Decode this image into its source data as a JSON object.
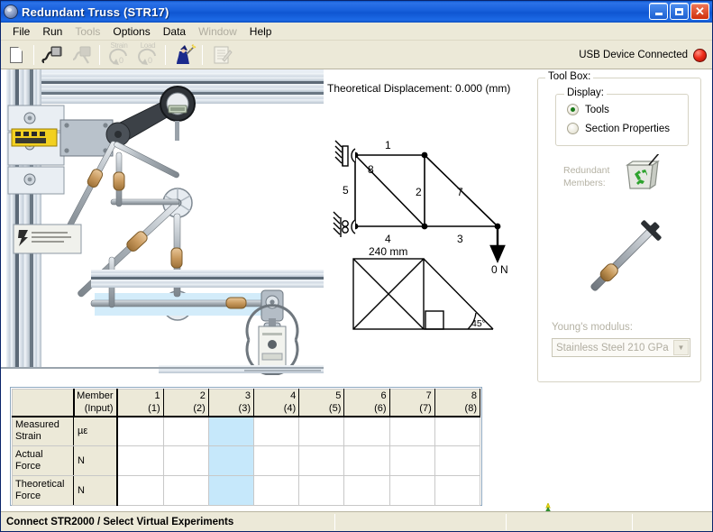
{
  "window": {
    "title": "Redundant Truss (STR17)",
    "icon": "app-globe-icon",
    "minimize": "–",
    "maximize": "❐",
    "close": "✕"
  },
  "menu": [
    {
      "label": "File",
      "enabled": true
    },
    {
      "label": "Run",
      "enabled": true
    },
    {
      "label": "Tools",
      "enabled": false
    },
    {
      "label": "Options",
      "enabled": true
    },
    {
      "label": "Data",
      "enabled": true
    },
    {
      "label": "Window",
      "enabled": false
    },
    {
      "label": "Help",
      "enabled": true
    }
  ],
  "toolbar": {
    "buttons": [
      {
        "name": "new-document-icon",
        "label": "",
        "enabled": true
      },
      {
        "name": "usb-connect-icon",
        "label": "",
        "enabled": true
      },
      {
        "name": "usb-disconnect-icon",
        "label": "",
        "enabled": false
      },
      {
        "name": "strain-zero-icon",
        "label": "Strain",
        "enabled": false
      },
      {
        "name": "load-zero-icon",
        "label": "Load",
        "enabled": false
      },
      {
        "name": "wizard-icon",
        "label": "",
        "enabled": true
      },
      {
        "name": "notes-icon",
        "label": "",
        "enabled": false
      }
    ]
  },
  "status": {
    "usb_text": "USB Device Connected",
    "usb_led_color": "#ef2d1a",
    "bar_text": "Connect STR2000 / Select Virtual Experiments"
  },
  "diagram": {
    "displacement_label": "Theoretical Displacement: 0.000 (mm)",
    "member_labels": [
      "1",
      "8",
      "5",
      "2",
      "7",
      "4",
      "3"
    ],
    "load_value": "0 N",
    "dimension": "240 mm",
    "angle": "45°"
  },
  "toolbox": {
    "legend": "Tool Box:",
    "display_legend": "Display:",
    "options": [
      {
        "label": "Tools",
        "selected": true
      },
      {
        "label": "Section Properties",
        "selected": false
      }
    ],
    "redundant_members_label": "Redundant Members:",
    "bin_icon": "recycle-bin-icon",
    "member_icon": "truss-member-icon",
    "youngs_modulus_label": "Young's modulus:",
    "youngs_modulus_value": "Stainless Steel  210 GPa",
    "dropdown_arrow": "▼"
  },
  "table": {
    "header": {
      "corner": "",
      "member": "Member",
      "member_sub": "(Input)",
      "columns": [
        {
          "top": "1",
          "sub": "(1)"
        },
        {
          "top": "2",
          "sub": "(2)"
        },
        {
          "top": "3",
          "sub": "(3)"
        },
        {
          "top": "4",
          "sub": "(4)"
        },
        {
          "top": "5",
          "sub": "(5)"
        },
        {
          "top": "6",
          "sub": "(6)"
        },
        {
          "top": "7",
          "sub": "(7)"
        },
        {
          "top": "8",
          "sub": "(8)"
        }
      ]
    },
    "rows": [
      {
        "label_line1": "Measured",
        "label_line2": "Strain",
        "unit": "µε",
        "values": [
          "",
          "",
          "",
          "",
          "",
          "",
          "",
          ""
        ]
      },
      {
        "label_line1": "Actual",
        "label_line2": "Force",
        "unit": "N",
        "values": [
          "",
          "",
          "",
          "",
          "",
          "",
          "",
          ""
        ]
      },
      {
        "label_line1": "Theoretical",
        "label_line2": "Force",
        "unit": "N",
        "values": [
          "",
          "",
          "",
          "",
          "",
          "",
          "",
          ""
        ]
      }
    ],
    "selected_column_index": 2,
    "selection_color": "#c6e8fb"
  },
  "tray": {
    "tree_icon": "christmas-tree-icon"
  }
}
